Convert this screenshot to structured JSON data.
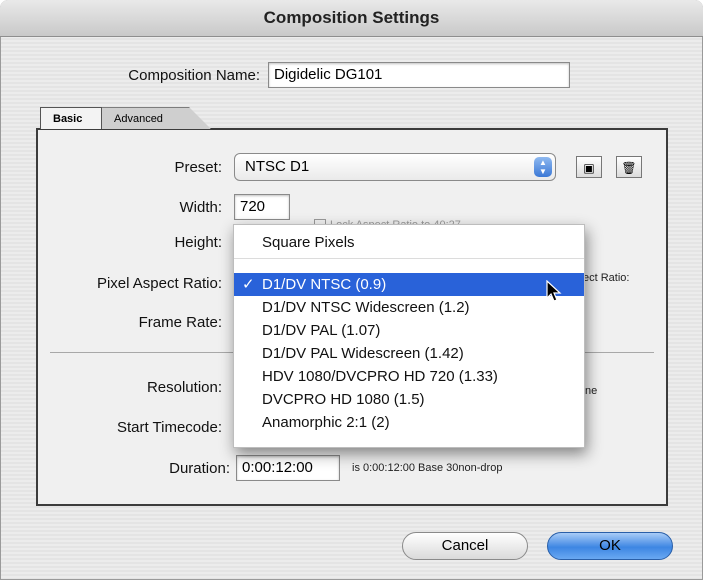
{
  "window": {
    "title": "Composition Settings"
  },
  "comp_name": {
    "label": "Composition Name:",
    "value": "Digidelic DG101"
  },
  "tabs": [
    {
      "label": "Basic",
      "active": true
    },
    {
      "label": "Advanced",
      "active": false
    }
  ],
  "basic": {
    "preset": {
      "label": "Preset:",
      "value": "NTSC D1"
    },
    "width": {
      "label": "Width:",
      "value": "720"
    },
    "height": {
      "label": "Height:"
    },
    "lock_aspect_partial": "Lock Aspect Ratio to 40:27",
    "pixel_aspect": {
      "label": "Pixel Aspect Ratio:"
    },
    "frame_aspect_partial": "ect Ratio:",
    "frame_rate": {
      "label": "Frame Rate:"
    },
    "resolution": {
      "label": "Resolution:"
    },
    "resolution_partial": "ne",
    "start_timecode": {
      "label": "Start Timecode:"
    },
    "duration": {
      "label": "Duration:",
      "value": "0:00:12:00",
      "note": "is 0:00:12:00  Base 30non-drop"
    }
  },
  "pixel_aspect_menu": {
    "items": [
      {
        "label": "Square Pixels",
        "selected": false
      },
      {
        "label": "D1/DV NTSC (0.9)",
        "selected": true
      },
      {
        "label": "D1/DV NTSC Widescreen (1.2)",
        "selected": false
      },
      {
        "label": "D1/DV PAL (1.07)",
        "selected": false
      },
      {
        "label": "D1/DV PAL Widescreen (1.42)",
        "selected": false
      },
      {
        "label": "HDV 1080/DVCPRO HD 720 (1.33)",
        "selected": false
      },
      {
        "label": "DVCPRO HD 1080 (1.5)",
        "selected": false
      },
      {
        "label": "Anamorphic 2:1 (2)",
        "selected": false
      }
    ],
    "check_glyph": "✓"
  },
  "icons": {
    "save": "save-preset-icon",
    "delete": "trash-icon",
    "popup_arrows": "updown-arrows-icon",
    "cursor": "mouse-pointer-icon"
  },
  "buttons": {
    "cancel": "Cancel",
    "ok": "OK"
  },
  "colors": {
    "selection": "#2962d9",
    "ok_button": "#3d86e3"
  }
}
